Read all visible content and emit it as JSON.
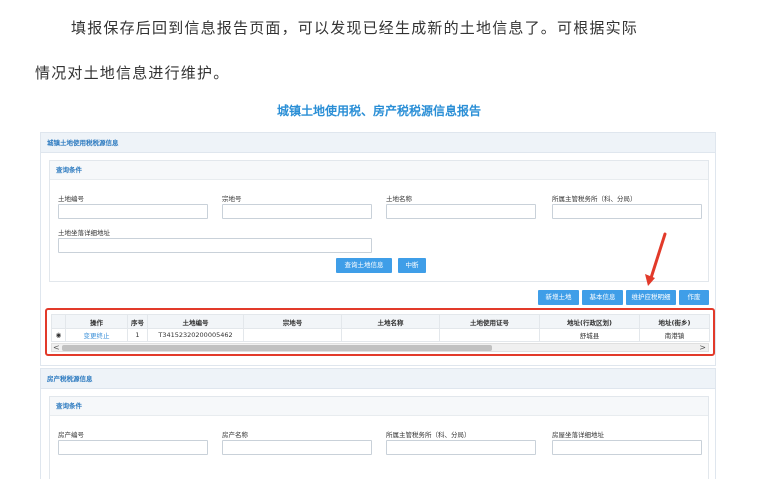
{
  "article": {
    "line1": "填报保存后回到信息报告页面，可以发现已经生成新的土地信息了。可根据实际",
    "line2": "情况对土地信息进行维护。"
  },
  "report": {
    "title": "城镇土地使用税、房产税税源信息报告",
    "land_section": {
      "title": "城镇土地使用税税源信息",
      "query_title": "查询条件",
      "fields": [
        {
          "label": "土地编号",
          "value": ""
        },
        {
          "label": "宗地号",
          "value": ""
        },
        {
          "label": "土地名称",
          "value": ""
        },
        {
          "label": "所属主管税务所（科、分局）",
          "value": ""
        },
        {
          "label": "土地坐落详细地址",
          "value": ""
        }
      ],
      "query_button": "查询土地信息",
      "reset_button": "中断",
      "action_buttons": [
        "新增土地",
        "基本信息",
        "维护应税明细",
        "作废"
      ],
      "table": {
        "headers": [
          "操作",
          "序号",
          "土地编号",
          "宗地号",
          "土地名称",
          "土地使用证号",
          "地址(行政区划)",
          "地址(街乡)"
        ],
        "rows": [
          {
            "radio": "◉",
            "action": "变更终止",
            "index": "1",
            "land_no": "T34152320200005462",
            "parcel_no": "",
            "land_name": "",
            "cert_no": "",
            "district": "舒城县",
            "street": "南港镇"
          }
        ],
        "scroll_left": "<",
        "scroll_right": ">"
      }
    },
    "house_section": {
      "title": "房产税税源信息",
      "query_title": "查询条件",
      "fields": [
        {
          "label": "房产编号",
          "value": ""
        },
        {
          "label": "房产名称",
          "value": ""
        },
        {
          "label": "所属主管税务所（科、分局）",
          "value": ""
        },
        {
          "label": "房屋坐落详细地址",
          "value": ""
        }
      ]
    }
  },
  "colors": {
    "accent": "#3f9ee8",
    "highlight": "#e23a2a",
    "title": "#2b8fd6"
  }
}
